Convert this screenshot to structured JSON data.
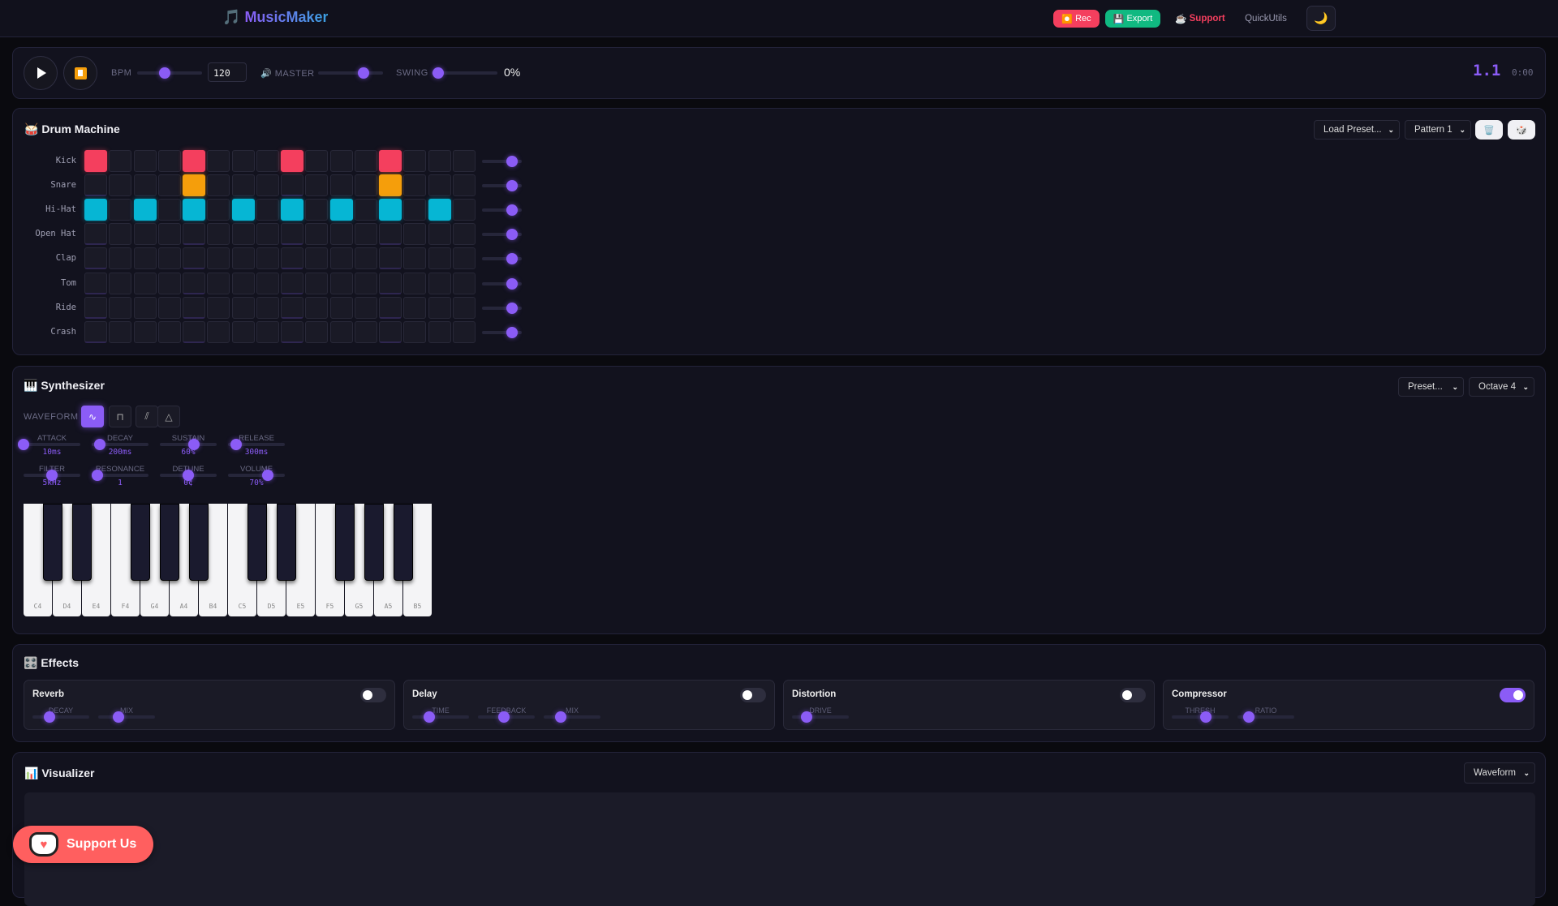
{
  "header": {
    "logo_icon": "🎵",
    "title": "MusicMaker",
    "rec": {
      "icon": "⏺️",
      "label": "Rec"
    },
    "export": {
      "icon": "💾",
      "label": "Export"
    },
    "support": {
      "icon": "☕",
      "label": "Support"
    },
    "quickutils": "QuickUtils",
    "theme_icon": "🌙"
  },
  "transport": {
    "bpm_label": "BPM",
    "bpm_value": "120",
    "bpm_fraction": 0.42,
    "master_icon": "🔊",
    "master_label": "MASTER",
    "master_fraction": 0.7,
    "swing_label": "SWING",
    "swing_value": "0%",
    "swing_fraction": 0.1,
    "position": "1.1",
    "time": "0:00"
  },
  "drum": {
    "icon": "🥁",
    "title": "Drum Machine",
    "preset_select": "Load Preset...",
    "pattern_select": "Pattern 1",
    "clear_icon": "🗑️",
    "random_icon": "🎲",
    "colors": {
      "Kick": "#f43f5e",
      "Snare": "#f59e0b",
      "Hi-Hat": "#06b6d4"
    },
    "tracks": [
      {
        "name": "Kick",
        "volume": 0.75,
        "steps": [
          1,
          0,
          0,
          0,
          1,
          0,
          0,
          0,
          1,
          0,
          0,
          0,
          1,
          0,
          0,
          0
        ]
      },
      {
        "name": "Snare",
        "volume": 0.75,
        "steps": [
          0,
          0,
          0,
          0,
          1,
          0,
          0,
          0,
          0,
          0,
          0,
          0,
          1,
          0,
          0,
          0
        ]
      },
      {
        "name": "Hi-Hat",
        "volume": 0.75,
        "steps": [
          1,
          0,
          1,
          0,
          1,
          0,
          1,
          0,
          1,
          0,
          1,
          0,
          1,
          0,
          1,
          0
        ]
      },
      {
        "name": "Open Hat",
        "volume": 0.75,
        "steps": [
          0,
          0,
          0,
          0,
          0,
          0,
          0,
          0,
          0,
          0,
          0,
          0,
          0,
          0,
          0,
          0
        ]
      },
      {
        "name": "Clap",
        "volume": 0.75,
        "steps": [
          0,
          0,
          0,
          0,
          0,
          0,
          0,
          0,
          0,
          0,
          0,
          0,
          0,
          0,
          0,
          0
        ]
      },
      {
        "name": "Tom",
        "volume": 0.75,
        "steps": [
          0,
          0,
          0,
          0,
          0,
          0,
          0,
          0,
          0,
          0,
          0,
          0,
          0,
          0,
          0,
          0
        ]
      },
      {
        "name": "Ride",
        "volume": 0.75,
        "steps": [
          0,
          0,
          0,
          0,
          0,
          0,
          0,
          0,
          0,
          0,
          0,
          0,
          0,
          0,
          0,
          0
        ]
      },
      {
        "name": "Crash",
        "volume": 0.75,
        "steps": [
          0,
          0,
          0,
          0,
          0,
          0,
          0,
          0,
          0,
          0,
          0,
          0,
          0,
          0,
          0,
          0
        ]
      }
    ]
  },
  "synth": {
    "icon": "🎹",
    "title": "Synthesizer",
    "preset_select": "Preset...",
    "octave_select": "Octave 4",
    "waveform_label": "WAVEFORM",
    "waveforms": [
      {
        "name": "sine",
        "glyph": "∿",
        "active": true
      },
      {
        "name": "square",
        "glyph": "⊓",
        "active": false
      },
      {
        "name": "sawtooth",
        "glyph": "⫽",
        "active": false
      },
      {
        "name": "triangle",
        "glyph": "△",
        "active": false
      }
    ],
    "params": [
      {
        "label": "ATTACK",
        "value": "10ms",
        "fraction": 0.0
      },
      {
        "label": "DECAY",
        "value": "200ms",
        "fraction": 0.14
      },
      {
        "label": "SUSTAIN",
        "value": "60%",
        "fraction": 0.6
      },
      {
        "label": "RELEASE",
        "value": "300ms",
        "fraction": 0.14
      },
      {
        "label": "FILTER",
        "value": "5kHz",
        "fraction": 0.5
      },
      {
        "label": "RESONANCE",
        "value": "1",
        "fraction": 0.1
      },
      {
        "label": "DETUNE",
        "value": "0¢",
        "fraction": 0.5
      },
      {
        "label": "VOLUME",
        "value": "70%",
        "fraction": 0.7
      }
    ],
    "keys": [
      "C4",
      "D4",
      "E4",
      "F4",
      "G4",
      "A4",
      "B4",
      "C5",
      "D5",
      "E5",
      "F5",
      "G5",
      "A5",
      "B5"
    ]
  },
  "effects": {
    "icon": "🎛️",
    "title": "Effects",
    "units": [
      {
        "name": "Reverb",
        "enabled": false,
        "params": [
          {
            "label": "DECAY",
            "fraction": 0.3
          },
          {
            "label": "MIX",
            "fraction": 0.35
          }
        ]
      },
      {
        "name": "Delay",
        "enabled": false,
        "params": [
          {
            "label": "TIME",
            "fraction": 0.3
          },
          {
            "label": "FEEDBACK",
            "fraction": 0.45
          },
          {
            "label": "MIX",
            "fraction": 0.3
          }
        ]
      },
      {
        "name": "Distortion",
        "enabled": false,
        "params": [
          {
            "label": "DRIVE",
            "fraction": 0.25
          }
        ]
      },
      {
        "name": "Compressor",
        "enabled": true,
        "params": [
          {
            "label": "THRESH",
            "fraction": 0.6
          },
          {
            "label": "RATIO",
            "fraction": 0.2
          }
        ]
      }
    ]
  },
  "visualizer": {
    "icon": "📊",
    "title": "Visualizer",
    "mode_select": "Waveform"
  },
  "support_us": {
    "label": "Support Us"
  },
  "accent": "#8b5cf6"
}
